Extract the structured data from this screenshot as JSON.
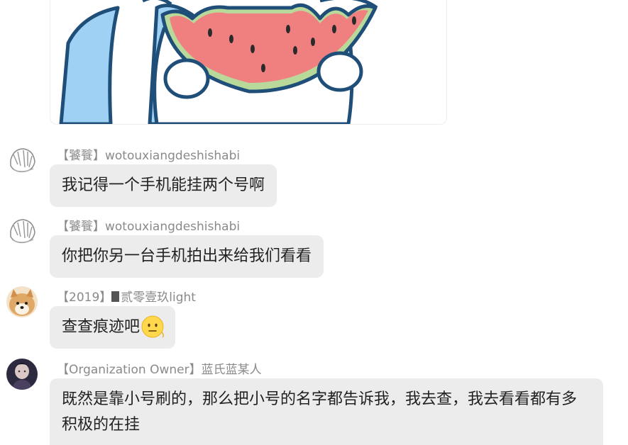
{
  "messages": [
    {
      "sender_tag": "【饕餮】",
      "sender_name": "wotouxiangdeshishabi",
      "text": "我记得一个手机能挂两个号啊"
    },
    {
      "sender_tag": "【饕餮】",
      "sender_name": "wotouxiangdeshishabi",
      "text": "你把你另一台手机拍出来给我们看看"
    },
    {
      "sender_tag": "【2019】",
      "sender_name": "贰零壹玖light",
      "text": "查查痕迹吧"
    },
    {
      "sender_tag": "【Organization Owner】",
      "sender_name": "蓝氏蓝某人",
      "text": "既然是靠小号刷的，那么把小号的名字都告诉我，我去查，我去看看都有多积极的在挂"
    }
  ],
  "icons": {
    "sticker": "watermelon-sticker-icon",
    "emoji": "slightly-smiling-face-emoji-icon"
  },
  "colors": {
    "bubble": "#ececec",
    "sender_text": "#8a8a8a",
    "message_text": "#222222",
    "watermelon_flesh": "#f08080",
    "watermelon_rind": "#9ccc8a",
    "character_blue": "#9fd1f5"
  }
}
